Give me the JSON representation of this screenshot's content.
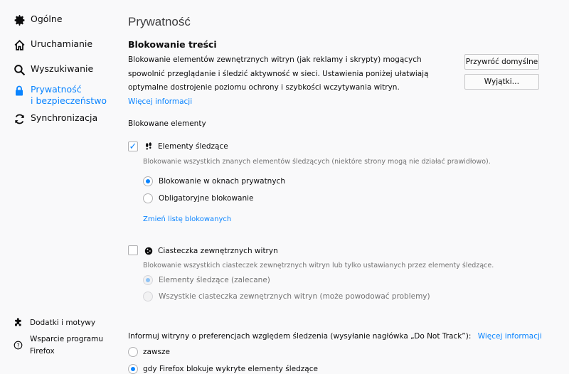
{
  "sidebar": {
    "items": [
      {
        "label": "Ogólne",
        "icon": "gear-icon"
      },
      {
        "label": "Uruchamianie",
        "icon": "home-icon"
      },
      {
        "label": "Wyszukiwanie",
        "icon": "search-icon"
      },
      {
        "label_line1": "Prywatność",
        "label_line2": "i bezpieczeństwo",
        "icon": "lock-icon",
        "active": true
      },
      {
        "label": "Synchronizacja",
        "icon": "sync-icon"
      }
    ],
    "footer": [
      {
        "label": "Dodatki i motywy",
        "icon": "puzzle-icon"
      },
      {
        "label_line1": "Wsparcie programu",
        "label_line2": "Firefox",
        "icon": "help-icon"
      }
    ]
  },
  "main": {
    "title": "Prywatność",
    "section_title": "Blokowanie treści",
    "description": "Blokowanie elementów zewnętrznych witryn (jak reklamy i skrypty) mogących spowolnić przeglądanie i śledzić aktywność w sieci. Ustawienia poniżej ułatwiają optymalne dostrojenie poziomu ochrony i szybkości wczytywania witryn.",
    "more_info": "Więcej informacji",
    "restore_defaults": "Przywróć domyślne",
    "exceptions": "Wyjątki…",
    "blocked_heading": "Blokowane elementy",
    "trackers": {
      "checked": true,
      "label": "Elementy śledzące",
      "hint": "Blokowanie wszystkich znanych elementów śledzących (niektóre strony mogą nie działać prawidłowo).",
      "option_private": "Blokowanie w oknach prywatnych",
      "option_always": "Obligatoryjne blokowanie",
      "selected": "private",
      "change_list": "Zmień listę blokowanych"
    },
    "cookies": {
      "checked": false,
      "label": "Ciasteczka zewnętrznych witryn",
      "hint": "Blokowanie wszystkich ciasteczek zewnętrznych witryn lub tylko ustawianych przez elementy śledzące.",
      "option_trackers": "Elementy śledzące (zalecane)",
      "option_all": "Wszystkie ciasteczka zewnętrznych witryn (może powodować problemy)"
    },
    "dnt": {
      "label": "Informuj witryny o preferencjach względem śledzenia (wysyłanie nagłówka „Do Not Track”):",
      "more_info": "Więcej informacji",
      "option_always": "zawsze",
      "option_when_blocking": "gdy Firefox blokuje wykryte elementy śledzące",
      "selected": "when_blocking"
    }
  },
  "colors": {
    "accent": "#0a84ff",
    "background": "#f9f9fa",
    "hint": "#737373"
  }
}
